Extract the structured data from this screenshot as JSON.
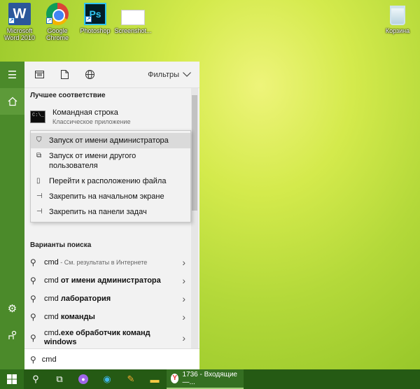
{
  "desktop": {
    "icons": [
      {
        "label": "Microsoft Word 2010",
        "glyph": "W"
      },
      {
        "label": "Google Chrome",
        "glyph": ""
      },
      {
        "label": "Photoshop",
        "glyph": "Ps"
      },
      {
        "label": "Screenshot...",
        "glyph": ""
      }
    ],
    "recycle_bin": {
      "label": "Корзина"
    }
  },
  "start_menu": {
    "filters_label": "Фильтры",
    "best_match_title": "Лучшее соответствие",
    "best_match": {
      "name": "Командная строка",
      "subtitle": "Классическое приложение",
      "thumb_text": "C:\\_"
    },
    "context_menu": [
      {
        "label": "Запуск от имени администратора",
        "icon": "shield-icon"
      },
      {
        "label": "Запуск от имени другого пользователя",
        "icon": "user-icon"
      },
      {
        "label": "Перейти к расположению файла",
        "icon": "folder-icon"
      },
      {
        "label": "Закрепить на начальном экране",
        "icon": "pin-icon"
      },
      {
        "label": "Закрепить на панели задач",
        "icon": "pin-icon"
      }
    ],
    "suggestions_title": "Варианты поиска",
    "suggestions": [
      {
        "prefix": "cmd",
        "rest": "",
        "hint": " - См. результаты в Интернете"
      },
      {
        "prefix": "cmd",
        "rest": " от имени администратора",
        "hint": ""
      },
      {
        "prefix": "cmd",
        "rest": " лаборатория",
        "hint": ""
      },
      {
        "prefix": "cmd",
        "rest": " команды",
        "hint": ""
      },
      {
        "prefix": "cmd",
        "rest": ".exe обработчик команд windows",
        "hint": ""
      }
    ],
    "search_value": "cmd"
  },
  "taskbar": {
    "yandex_label": "1736 - Входящие —..."
  },
  "colors": {
    "start_rail": "#4b8a2a",
    "taskbar": "#255a14",
    "panel_bg": "#f2f2f2",
    "highlight": "#dadada"
  }
}
